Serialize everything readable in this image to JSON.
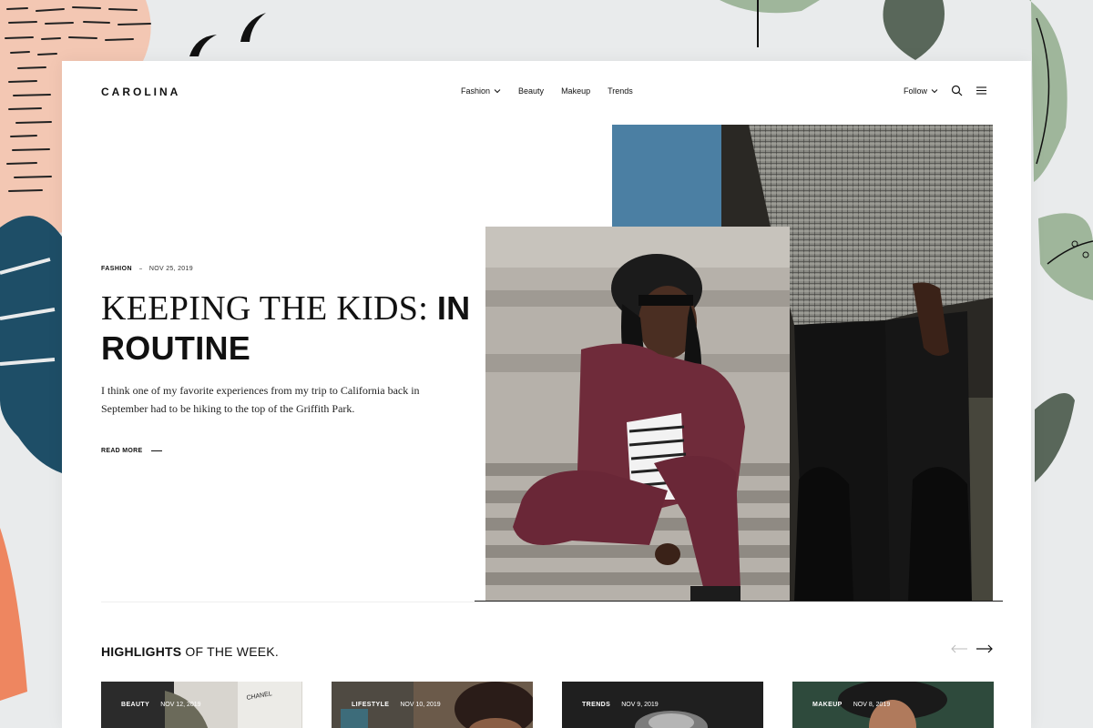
{
  "brand": {
    "logo": "CAROLINA"
  },
  "nav": {
    "items": [
      {
        "label": "Fashion",
        "has_dropdown": true
      },
      {
        "label": "Beauty",
        "has_dropdown": false
      },
      {
        "label": "Makeup",
        "has_dropdown": false
      },
      {
        "label": "Trends",
        "has_dropdown": false
      }
    ],
    "follow_label": "Follow",
    "icons": [
      "chevron-down-icon",
      "search-icon",
      "menu-icon"
    ]
  },
  "hero": {
    "category": "FASHION",
    "date": "NOV 25, 2019",
    "title_light": "KEEPING THE KIDS: ",
    "title_bold": "IN ROUTINE",
    "excerpt": "I think one of my favorite experiences from my trip to California back in September had to be hiking to the top of the Griffith Park.",
    "read_more": "READ MORE"
  },
  "highlights": {
    "title_bold": "HIGHLIGHTS",
    "title_rest": " OF THE WEEK.",
    "cards": [
      {
        "category": "BEAUTY",
        "date": "NOV 12, 2019",
        "overlay_text": "CHANEL"
      },
      {
        "category": "LIFESTYLE",
        "date": "NOV 10, 2019"
      },
      {
        "category": "TRENDS",
        "date": "NOV 9, 2019"
      },
      {
        "category": "MAKEUP",
        "date": "NOV 8, 2019"
      }
    ]
  },
  "colors": {
    "background": "#e9ebec",
    "text": "#111111",
    "leaf_green": "#9fb69b",
    "leaf_teal": "#1e4e67",
    "peach": "#f3c7b3",
    "coral": "#ee8660",
    "jacket_burgundy": "#6f2b3a"
  }
}
